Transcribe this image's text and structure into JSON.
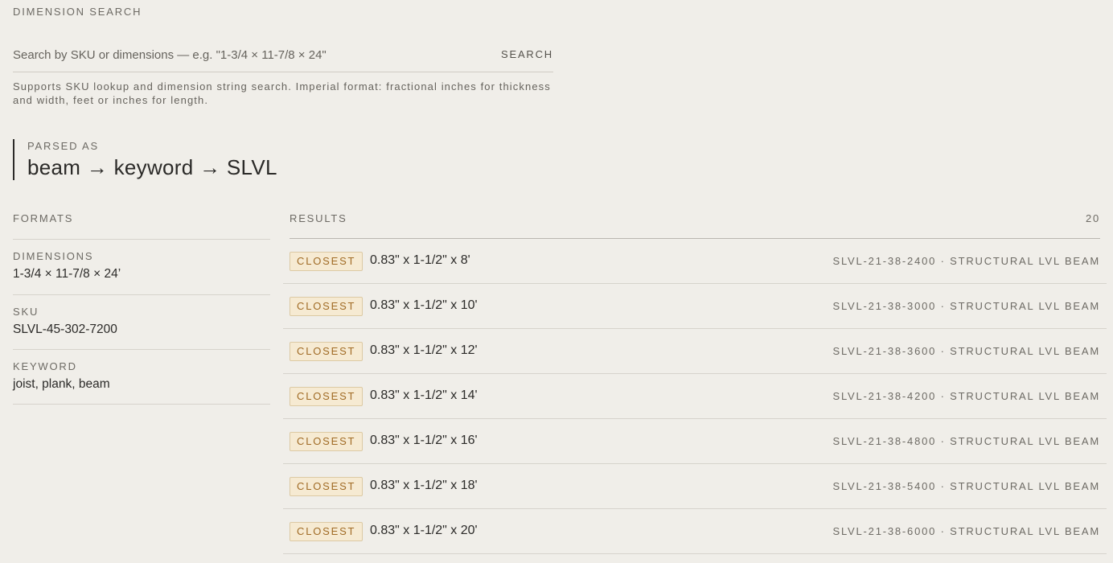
{
  "search": {
    "title": "DIMENSION SEARCH",
    "placeholder": "Search by SKU or dimensions — e.g. \"1-3/4 × 11-7/8 × 24\"",
    "button_label": "SEARCH",
    "help_text": "Supports SKU lookup and dimension string search. Imperial format: fractional inches for thickness and width, feet or inches for length."
  },
  "parsed": {
    "label": "PARSED AS",
    "value": "beam → keyword → SLVL"
  },
  "formats": {
    "title": "FORMATS",
    "items": [
      {
        "label": "DIMENSIONS",
        "value": "1-3/4 × 11-7/8 × 24’"
      },
      {
        "label": "SKU",
        "value": "SLVL-45-302-7200"
      },
      {
        "label": "KEYWORD",
        "value": "joist, plank, beam"
      }
    ]
  },
  "results": {
    "title": "RESULTS",
    "count": "20",
    "rows": [
      {
        "badge": "CLOSEST",
        "dims": "0.83\" x 1-1/2\" x 8'",
        "meta": "SLVL-21-38-2400 · STRUCTURAL LVL BEAM"
      },
      {
        "badge": "CLOSEST",
        "dims": "0.83\" x 1-1/2\" x 10'",
        "meta": "SLVL-21-38-3000 · STRUCTURAL LVL BEAM"
      },
      {
        "badge": "CLOSEST",
        "dims": "0.83\" x 1-1/2\" x 12'",
        "meta": "SLVL-21-38-3600 · STRUCTURAL LVL BEAM"
      },
      {
        "badge": "CLOSEST",
        "dims": "0.83\" x 1-1/2\" x 14'",
        "meta": "SLVL-21-38-4200 · STRUCTURAL LVL BEAM"
      },
      {
        "badge": "CLOSEST",
        "dims": "0.83\" x 1-1/2\" x 16'",
        "meta": "SLVL-21-38-4800 · STRUCTURAL LVL BEAM"
      },
      {
        "badge": "CLOSEST",
        "dims": "0.83\" x 1-1/2\" x 18'",
        "meta": "SLVL-21-38-5400 · STRUCTURAL LVL BEAM"
      },
      {
        "badge": "CLOSEST",
        "dims": "0.83\" x 1-1/2\" x 20'",
        "meta": "SLVL-21-38-6000 · STRUCTURAL LVL BEAM"
      }
    ]
  },
  "colors": {
    "background": "#f0eee9",
    "badge_bg": "#f6ead2",
    "badge_text": "#a06b25"
  }
}
